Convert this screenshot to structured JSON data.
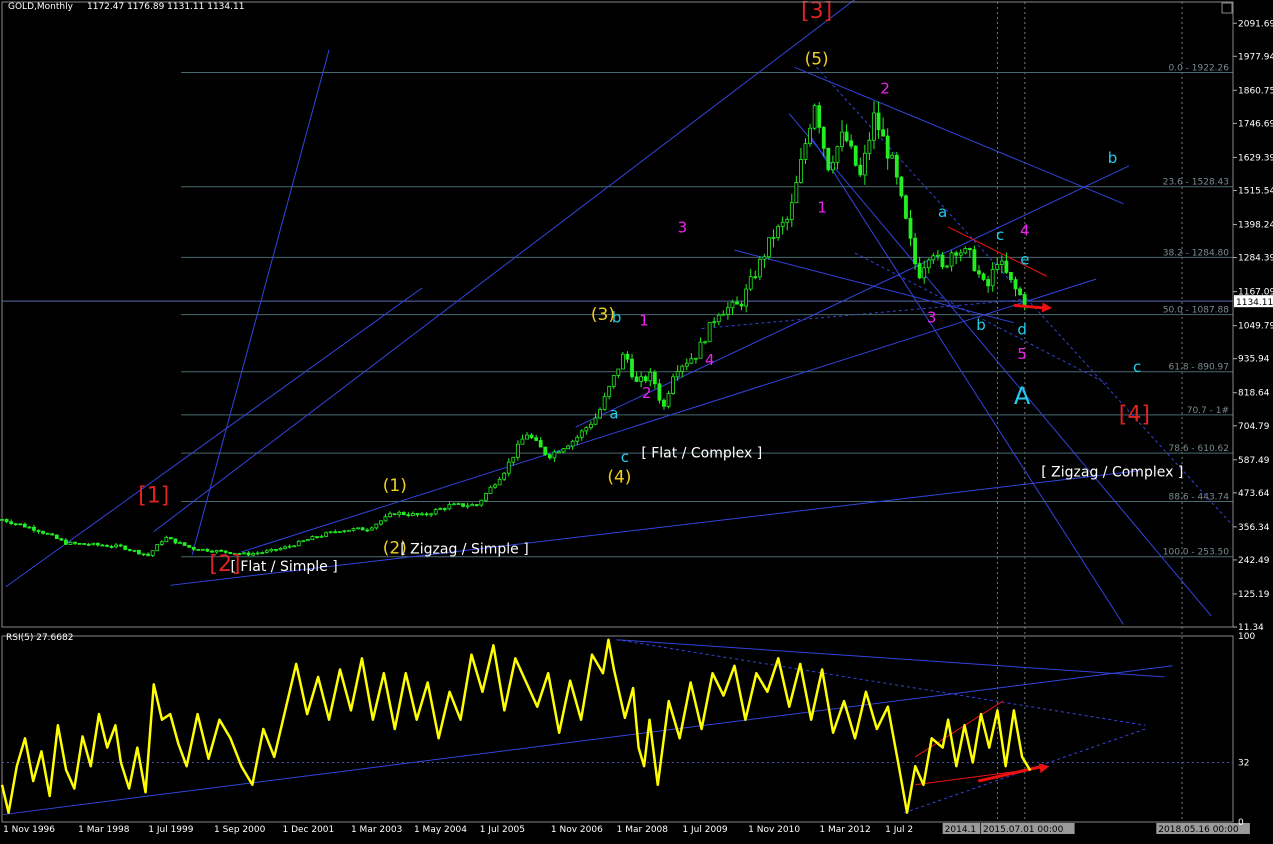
{
  "colors": {
    "background": "#000000",
    "price_candles": "#22ee22",
    "rsi_line": "#ffff00",
    "trendlines": "#3344dd",
    "fib_lines": "#4a6a70",
    "wave_primary": "#dd2222",
    "wave_intermediate": "#f0d020",
    "wave_minor": "#ee22ee",
    "wave_minute": "#22ccee",
    "arrow": "#ee1111",
    "axis_text": "#ffffff"
  },
  "chart_data": [
    {
      "type": "candlestick",
      "title": "GOLD,Monthly",
      "ohlc": "1172.47 1176.89 1131.11 1134.11",
      "current_price_label": "1134.11",
      "y_ticks": [
        "2091.69",
        "1977.94",
        "1860.75",
        "1746.69",
        "1629.39",
        "1515.54",
        "1398.24",
        "1284.39",
        "1167.09",
        "1049.79",
        "935.94",
        "818.64",
        "704.79",
        "587.49",
        "473.64",
        "356.34",
        "242.49",
        "125.19",
        "11.34"
      ],
      "ylim": [
        11.34,
        2165
      ],
      "x_ticks": [
        "1 Nov 1996",
        "1 Mar 1998",
        "1 Jul 1999",
        "1 Sep 2000",
        "1 Dec 2001",
        "1 Mar 2003",
        "1 May 2004",
        "1 Jul 2005",
        "1 Nov 2006",
        "1 Mar 2008",
        "1 Jul 2009",
        "1 Nov 2010",
        "1 Mar 2012",
        "1 Jul 2",
        "2014.1",
        "2015.07.01 00:00",
        "2018.05.16 00:00"
      ],
      "price_path": [
        [
          1996.83,
          382
        ],
        [
          1997.5,
          345
        ],
        [
          1998.0,
          300
        ],
        [
          1998.5,
          295
        ],
        [
          1999.0,
          288
        ],
        [
          1999.5,
          258
        ],
        [
          1999.8,
          320
        ],
        [
          2000.3,
          282
        ],
        [
          2000.8,
          272
        ],
        [
          2001.3,
          262
        ],
        [
          2001.7,
          272
        ],
        [
          2002.0,
          285
        ],
        [
          2002.5,
          318
        ],
        [
          2003.0,
          345
        ],
        [
          2003.5,
          350
        ],
        [
          2004.0,
          405
        ],
        [
          2004.5,
          395
        ],
        [
          2005.0,
          430
        ],
        [
          2005.5,
          432
        ],
        [
          2006.0,
          550
        ],
        [
          2006.4,
          680
        ],
        [
          2006.8,
          600
        ],
        [
          2007.3,
          660
        ],
        [
          2007.7,
          740
        ],
        [
          2008.2,
          960
        ],
        [
          2008.4,
          850
        ],
        [
          2008.7,
          880
        ],
        [
          2008.9,
          760
        ],
        [
          2009.1,
          900
        ],
        [
          2009.5,
          950
        ],
        [
          2009.9,
          1100
        ],
        [
          2010.3,
          1120
        ],
        [
          2010.9,
          1360
        ],
        [
          2011.2,
          1420
        ],
        [
          2011.67,
          1830
        ],
        [
          2011.9,
          1600
        ],
        [
          2012.2,
          1710
        ],
        [
          2012.5,
          1560
        ],
        [
          2012.75,
          1770
        ],
        [
          2013.1,
          1600
        ],
        [
          2013.3,
          1430
        ],
        [
          2013.55,
          1220
        ],
        [
          2013.8,
          1320
        ],
        [
          2014.0,
          1240
        ],
        [
          2014.2,
          1320
        ],
        [
          2014.5,
          1290
        ],
        [
          2014.8,
          1170
        ],
        [
          2015.0,
          1280
        ],
        [
          2015.3,
          1180
        ],
        [
          2015.5,
          1134
        ]
      ],
      "fib_levels": [
        {
          "label": "0.0 - 1922.26",
          "value": 1922.26
        },
        {
          "label": "23.6 - 1528.43",
          "value": 1528.43
        },
        {
          "label": "38.2 - 1284.80",
          "value": 1284.8
        },
        {
          "label": "50.0 - 1087.88",
          "value": 1087.88
        },
        {
          "label": "61.8 - 890.97",
          "value": 890.97
        },
        {
          "label": "70.7 - 1#",
          "value": 742.4
        },
        {
          "label": "78.6 - 610.62",
          "value": 610.62
        },
        {
          "label": "88.6 - 443.74",
          "value": 443.74
        },
        {
          "label": "100.0 - 253.50",
          "value": 253.5
        }
      ],
      "annotations": [
        {
          "text": "[1]",
          "group": "primary",
          "at": [
            1999.6,
            440
          ]
        },
        {
          "text": "[2]",
          "group": "primary",
          "at": [
            2000.9,
            205
          ]
        },
        {
          "text": "[3]",
          "group": "primary",
          "at": [
            2011.7,
            2110
          ]
        },
        {
          "text": "[4]",
          "group": "primary",
          "at": [
            2017.5,
            720
          ]
        },
        {
          "text": "(1)",
          "group": "intermediate",
          "at": [
            2004.0,
            480
          ]
        },
        {
          "text": "(2)",
          "group": "intermediate",
          "at": [
            2004.0,
            265
          ]
        },
        {
          "text": "(3)",
          "group": "intermediate",
          "at": [
            2007.8,
            1070
          ]
        },
        {
          "text": "(4)",
          "group": "intermediate",
          "at": [
            2008.1,
            510
          ]
        },
        {
          "text": "(5)",
          "group": "intermediate",
          "at": [
            2011.7,
            1950
          ]
        },
        {
          "text": "[ Flat / Simple ]",
          "group": "plain",
          "at": [
            2001.0,
            205
          ]
        },
        {
          "text": "[ Zigzag / Simple ]",
          "group": "plain",
          "at": [
            2004.1,
            265
          ]
        },
        {
          "text": "[ Flat / Complex ]",
          "group": "plain",
          "at": [
            2008.5,
            595
          ]
        },
        {
          "text": "[ Zigzag / Complex ]",
          "group": "plain",
          "at": [
            2015.8,
            530
          ]
        },
        {
          "text": "1",
          "group": "minor",
          "at": [
            2008.55,
            1050
          ]
        },
        {
          "text": "2",
          "group": "minor",
          "at": [
            2008.6,
            800
          ]
        },
        {
          "text": "3",
          "group": "minor",
          "at": [
            2009.25,
            1370
          ]
        },
        {
          "text": "4",
          "group": "minor",
          "at": [
            2009.75,
            915
          ]
        },
        {
          "text": "1",
          "group": "minor",
          "at": [
            2011.8,
            1440
          ]
        },
        {
          "text": "2",
          "group": "minor",
          "at": [
            2012.95,
            1850
          ]
        },
        {
          "text": "3",
          "group": "minor",
          "at": [
            2013.8,
            1060
          ]
        },
        {
          "text": "4",
          "group": "minor",
          "at": [
            2015.5,
            1360
          ]
        },
        {
          "text": "5",
          "group": "minor",
          "at": [
            2015.45,
            935
          ]
        },
        {
          "text": "a",
          "group": "minute",
          "at": [
            2008.0,
            730
          ]
        },
        {
          "text": "b",
          "group": "minute",
          "at": [
            2008.05,
            1060
          ]
        },
        {
          "text": "c",
          "group": "minute",
          "at": [
            2008.2,
            580
          ]
        },
        {
          "text": "a",
          "group": "minute",
          "at": [
            2014.0,
            1425
          ]
        },
        {
          "text": "b",
          "group": "minute",
          "at": [
            2014.7,
            1035
          ]
        },
        {
          "text": "c",
          "group": "minute",
          "at": [
            2015.05,
            1345
          ]
        },
        {
          "text": "d",
          "group": "minute",
          "at": [
            2015.45,
            1020
          ]
        },
        {
          "text": "e",
          "group": "minute",
          "at": [
            2015.5,
            1260
          ]
        },
        {
          "text": "b",
          "group": "minute",
          "at": [
            2017.1,
            1610
          ]
        },
        {
          "text": "c",
          "group": "minute",
          "at": [
            2017.55,
            890
          ]
        },
        {
          "text": "A",
          "group": "minute_big",
          "at": [
            2015.45,
            780
          ]
        }
      ]
    },
    {
      "type": "line",
      "title": "RSI(5) 27.6682",
      "ylim": [
        0,
        100
      ],
      "y_ticks": [
        "100",
        "32",
        "0"
      ],
      "reference_level": 32,
      "series": [
        {
          "name": "RSI(5)",
          "points": [
            [
              1996.83,
              20
            ],
            [
              1996.95,
              5
            ],
            [
              1997.1,
              30
            ],
            [
              1997.25,
              45
            ],
            [
              1997.4,
              22
            ],
            [
              1997.55,
              38
            ],
            [
              1997.7,
              14
            ],
            [
              1997.85,
              52
            ],
            [
              1998.0,
              28
            ],
            [
              1998.15,
              18
            ],
            [
              1998.3,
              46
            ],
            [
              1998.45,
              30
            ],
            [
              1998.6,
              58
            ],
            [
              1998.75,
              40
            ],
            [
              1998.9,
              52
            ],
            [
              1999.0,
              32
            ],
            [
              1999.15,
              18
            ],
            [
              1999.3,
              40
            ],
            [
              1999.45,
              16
            ],
            [
              1999.6,
              74
            ],
            [
              1999.75,
              55
            ],
            [
              1999.9,
              58
            ],
            [
              2000.05,
              42
            ],
            [
              2000.2,
              30
            ],
            [
              2000.4,
              58
            ],
            [
              2000.6,
              34
            ],
            [
              2000.8,
              55
            ],
            [
              2001.0,
              45
            ],
            [
              2001.2,
              30
            ],
            [
              2001.4,
              20
            ],
            [
              2001.6,
              50
            ],
            [
              2001.8,
              35
            ],
            [
              2002.0,
              60
            ],
            [
              2002.2,
              85
            ],
            [
              2002.4,
              58
            ],
            [
              2002.6,
              78
            ],
            [
              2002.8,
              55
            ],
            [
              2003.0,
              82
            ],
            [
              2003.2,
              60
            ],
            [
              2003.4,
              88
            ],
            [
              2003.6,
              55
            ],
            [
              2003.8,
              80
            ],
            [
              2004.0,
              50
            ],
            [
              2004.2,
              80
            ],
            [
              2004.4,
              55
            ],
            [
              2004.6,
              75
            ],
            [
              2004.8,
              45
            ],
            [
              2005.0,
              70
            ],
            [
              2005.2,
              55
            ],
            [
              2005.4,
              90
            ],
            [
              2005.6,
              70
            ],
            [
              2005.8,
              95
            ],
            [
              2006.0,
              60
            ],
            [
              2006.2,
              88
            ],
            [
              2006.4,
              75
            ],
            [
              2006.6,
              62
            ],
            [
              2006.8,
              80
            ],
            [
              2007.0,
              48
            ],
            [
              2007.2,
              76
            ],
            [
              2007.4,
              55
            ],
            [
              2007.6,
              90
            ],
            [
              2007.8,
              80
            ],
            [
              2007.9,
              98
            ],
            [
              2008.0,
              82
            ],
            [
              2008.2,
              56
            ],
            [
              2008.35,
              72
            ],
            [
              2008.45,
              40
            ],
            [
              2008.55,
              30
            ],
            [
              2008.65,
              55
            ],
            [
              2008.8,
              20
            ],
            [
              2009.0,
              65
            ],
            [
              2009.2,
              45
            ],
            [
              2009.4,
              75
            ],
            [
              2009.6,
              50
            ],
            [
              2009.8,
              80
            ],
            [
              2010.0,
              68
            ],
            [
              2010.2,
              84
            ],
            [
              2010.4,
              55
            ],
            [
              2010.6,
              80
            ],
            [
              2010.8,
              70
            ],
            [
              2011.0,
              88
            ],
            [
              2011.2,
              62
            ],
            [
              2011.4,
              85
            ],
            [
              2011.6,
              55
            ],
            [
              2011.8,
              82
            ],
            [
              2012.0,
              48
            ],
            [
              2012.2,
              65
            ],
            [
              2012.4,
              45
            ],
            [
              2012.6,
              70
            ],
            [
              2012.8,
              50
            ],
            [
              2013.0,
              62
            ],
            [
              2013.2,
              30
            ],
            [
              2013.35,
              5
            ],
            [
              2013.5,
              30
            ],
            [
              2013.65,
              20
            ],
            [
              2013.8,
              45
            ],
            [
              2014.0,
              40
            ],
            [
              2014.1,
              55
            ],
            [
              2014.25,
              30
            ],
            [
              2014.4,
              52
            ],
            [
              2014.55,
              32
            ],
            [
              2014.7,
              58
            ],
            [
              2014.85,
              40
            ],
            [
              2015.0,
              60
            ],
            [
              2015.15,
              30
            ],
            [
              2015.3,
              60
            ],
            [
              2015.45,
              35
            ],
            [
              2015.6,
              27.67
            ]
          ]
        }
      ]
    }
  ]
}
